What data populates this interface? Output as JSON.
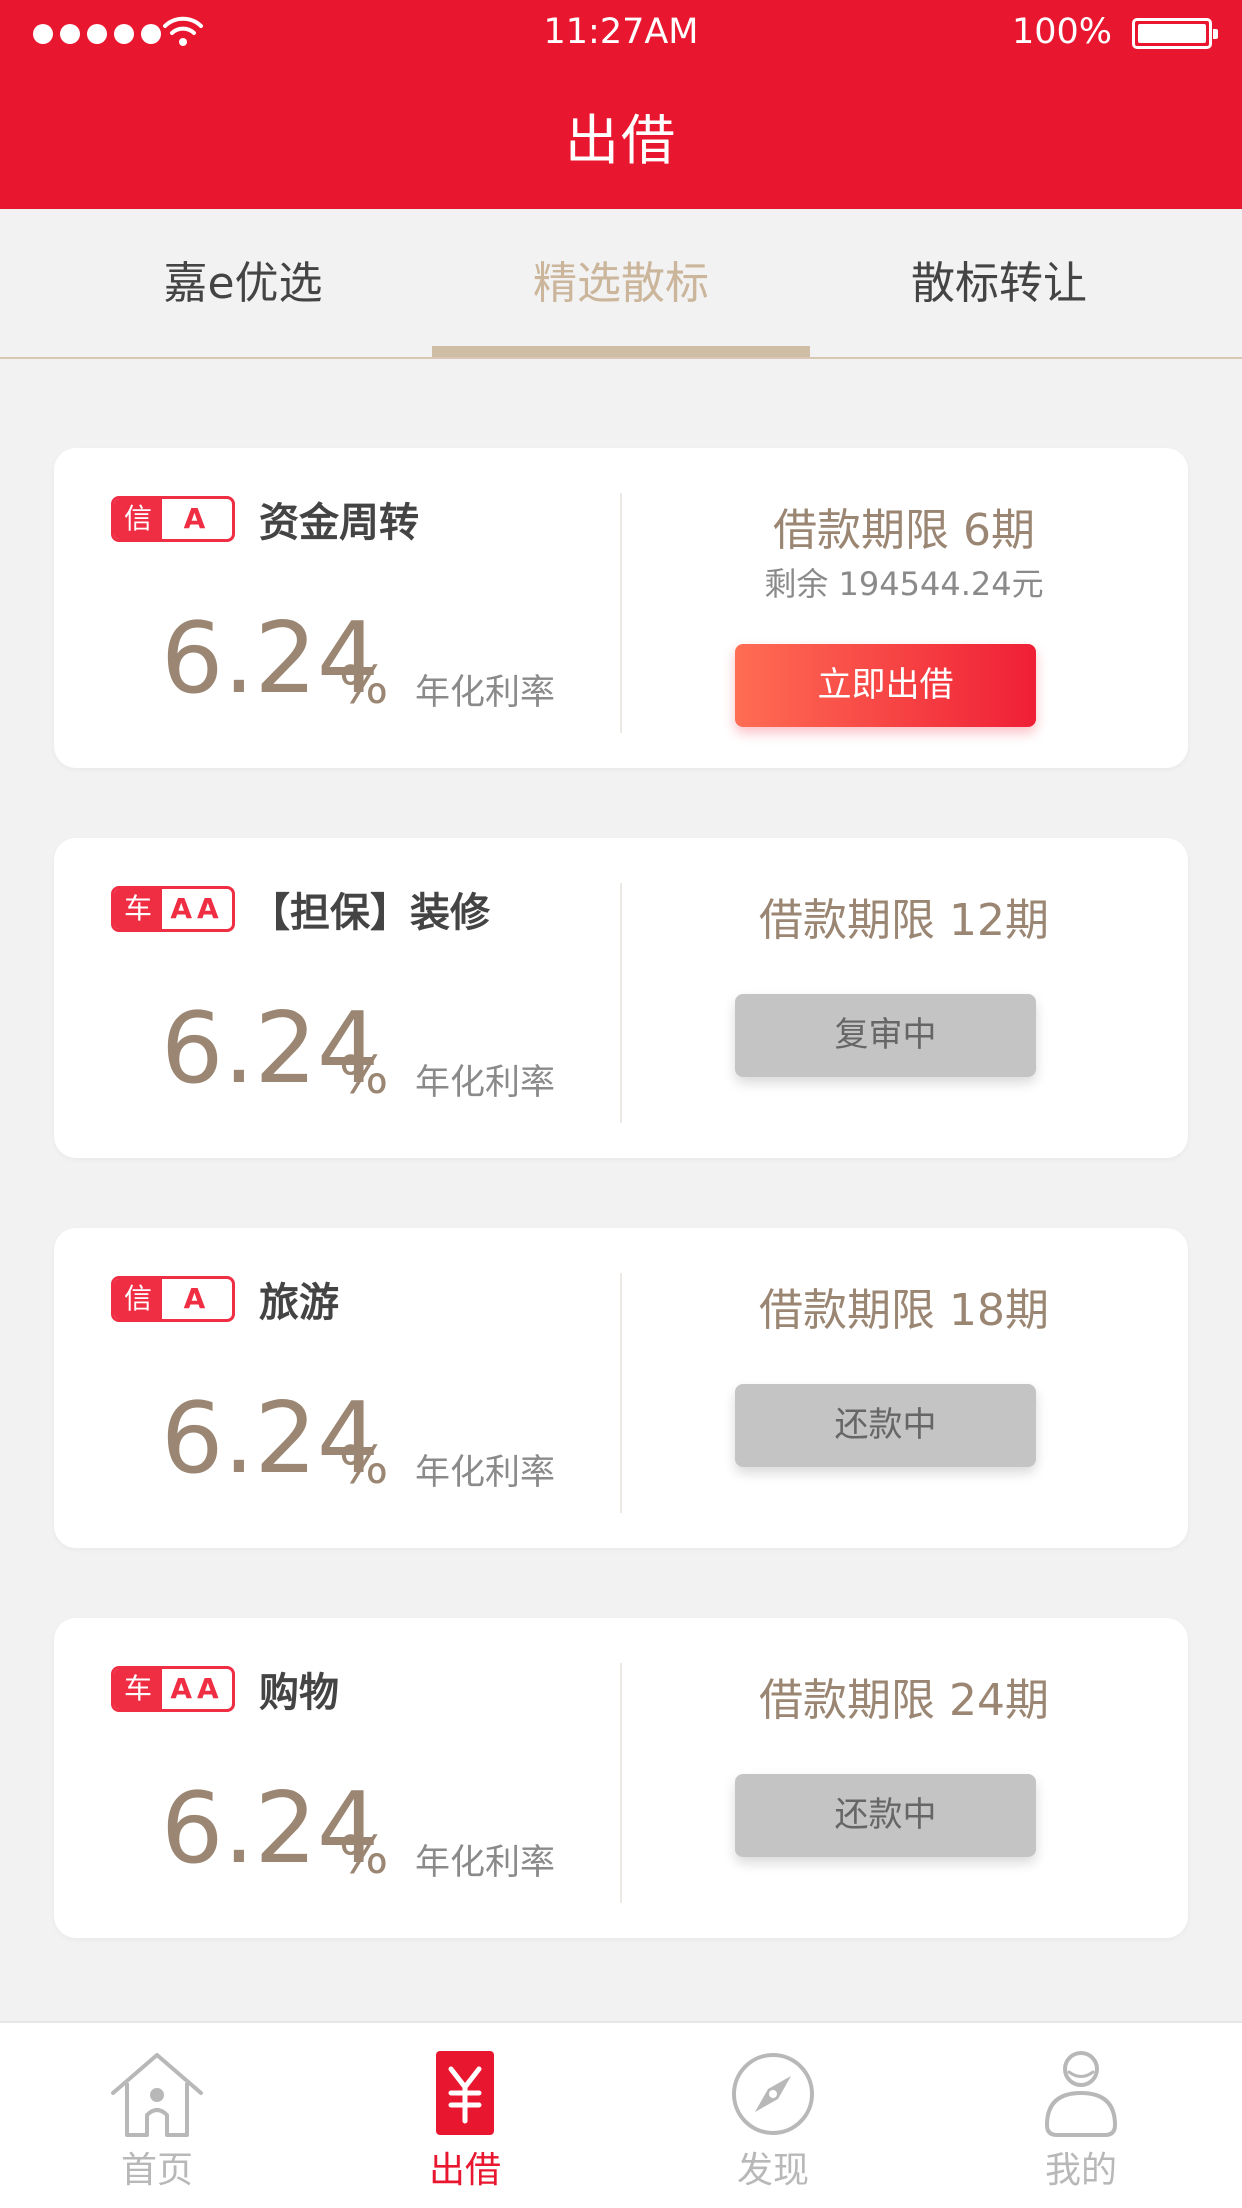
{
  "status_bar": {
    "time": "11:27AM",
    "battery": "100%"
  },
  "header": {
    "title": "出借"
  },
  "tabs": [
    {
      "label": "嘉e优选"
    },
    {
      "label": "精选散标"
    },
    {
      "label": "散标转让"
    }
  ],
  "active_tab": "精选散标",
  "colors": {
    "brand_red": "#e8172f",
    "accent_gold": "#cbb69c",
    "rate_brown": "#9a8672",
    "disabled_gray": "#c4c4c4"
  },
  "loans": [
    {
      "type": "信",
      "grade": "A",
      "title": "资金周转",
      "rate": "6.24",
      "rate_unit": "%",
      "rate_label": "年化利率",
      "term": "借款期限  6期",
      "remaining": "剩余 194544.24元",
      "button": "立即出借"
    },
    {
      "type": "车",
      "grade": "AA",
      "title": "【担保】装修",
      "rate": "6.24",
      "rate_unit": "%",
      "rate_label": "年化利率",
      "term": "借款期限  12期",
      "button": "复审中"
    },
    {
      "type": "信",
      "grade": "A",
      "title": "旅游",
      "rate": "6.24",
      "rate_unit": "%",
      "rate_label": "年化利率",
      "term": "借款期限  18期",
      "button": "还款中"
    },
    {
      "type": "车",
      "grade": "AA",
      "title": "购物",
      "rate": "6.24",
      "rate_unit": "%",
      "rate_label": "年化利率",
      "term": "借款期限  24期",
      "button": "还款中"
    }
  ],
  "bottom_nav": [
    {
      "label": "首页",
      "icon": "home-icon"
    },
    {
      "label": "出借",
      "icon": "yen-icon"
    },
    {
      "label": "发现",
      "icon": "compass-icon"
    },
    {
      "label": "我的",
      "icon": "user-icon"
    }
  ],
  "active_nav": "出借"
}
